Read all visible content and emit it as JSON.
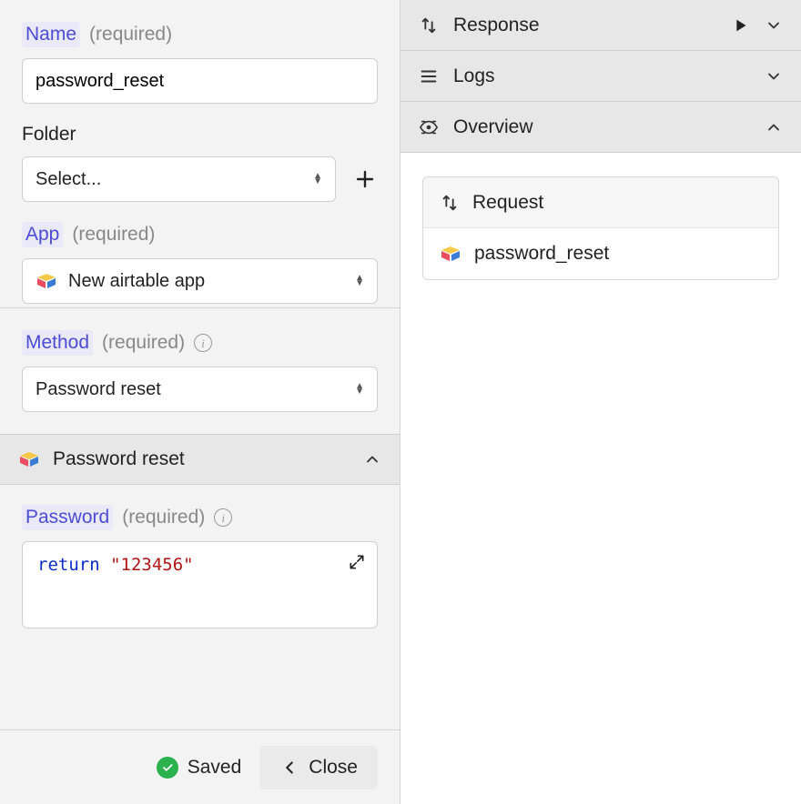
{
  "left": {
    "name": {
      "label": "Name",
      "hint": "(required)",
      "value": "password_reset"
    },
    "folder": {
      "label": "Folder",
      "placeholder": "Select..."
    },
    "app": {
      "label": "App",
      "hint": "(required)",
      "value": "New airtable app"
    },
    "method": {
      "label": "Method",
      "hint": "(required)",
      "value": "Password reset"
    },
    "methodHeader": "Password reset",
    "password": {
      "label": "Password",
      "hint": "(required)",
      "keyword": "return",
      "string": "\"123456\""
    },
    "footer": {
      "saved": "Saved",
      "close": "Close"
    }
  },
  "right": {
    "response": "Response",
    "logs": "Logs",
    "overview": "Overview",
    "items": {
      "request": "Request",
      "resource": "password_reset"
    }
  }
}
